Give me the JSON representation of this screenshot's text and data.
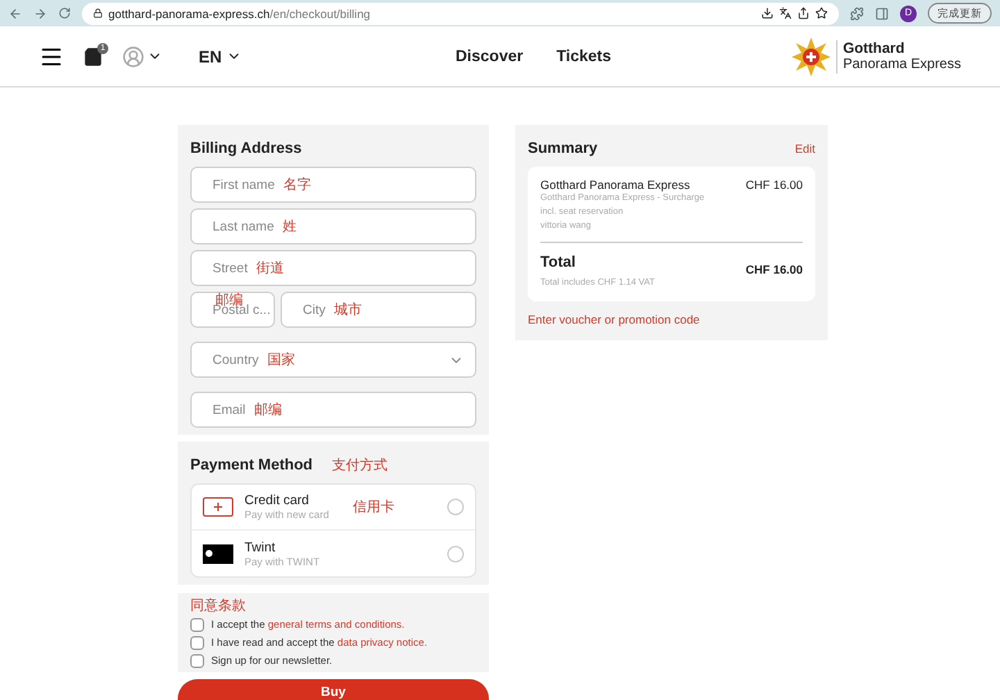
{
  "browser": {
    "url_host": "gotthard-panorama-express.ch",
    "url_path": "/en/checkout/billing",
    "profile": "D",
    "update_button": "完成更新"
  },
  "header": {
    "cart_count": "1",
    "language": "EN",
    "nav": [
      "Discover",
      "Tickets"
    ],
    "logo_title": "Gotthard",
    "logo_subtitle": "Panorama Express"
  },
  "billing": {
    "title": "Billing Address",
    "fields": [
      {
        "kind": "full",
        "placeholder": "First name",
        "annotation": "名字"
      },
      {
        "kind": "full",
        "placeholder": "Last name",
        "annotation": "姓"
      },
      {
        "kind": "full",
        "placeholder": "Street",
        "annotation": "街道"
      },
      {
        "kind": "pair",
        "placeholder": "Postal c...",
        "annotation": "邮编",
        "second": {
          "placeholder": "City",
          "annotation": "城市"
        }
      },
      {
        "kind": "select",
        "placeholder": "Country",
        "annotation": "国家"
      },
      {
        "kind": "full",
        "placeholder": "Email",
        "annotation": "邮编"
      }
    ]
  },
  "payment": {
    "title": "Payment Method",
    "annotation": "支付方式",
    "options": [
      {
        "kind": "card",
        "name": "Credit card",
        "hint": "Pay with new card",
        "annotation": "信用卡",
        "selected": false
      },
      {
        "kind": "twint",
        "name": "Twint",
        "hint": "Pay with TWINT",
        "selected": false
      }
    ]
  },
  "consents": {
    "annotation": "同意条款",
    "items": [
      {
        "text": "I accept the ",
        "link": "general terms and conditions.",
        "checked": false
      },
      {
        "text": "I have read and accept the ",
        "link": "data privacy notice.",
        "checked": false
      },
      {
        "text": "Sign up for our newsletter.",
        "checked": false
      }
    ]
  },
  "buy_button": "Buy",
  "summary": {
    "title": "Summary",
    "edit": "Edit",
    "item": {
      "name": "Gotthard Panorama Express",
      "price": "CHF 16.00",
      "details": [
        "Gotthard Panorama Express - Surcharge",
        "incl. seat reservation",
        "vittoria wang"
      ]
    },
    "total_label": "Total",
    "total_price": "CHF 16.00",
    "vat": "Total includes CHF 1.14 VAT",
    "voucher": "Enter voucher or promotion code"
  }
}
